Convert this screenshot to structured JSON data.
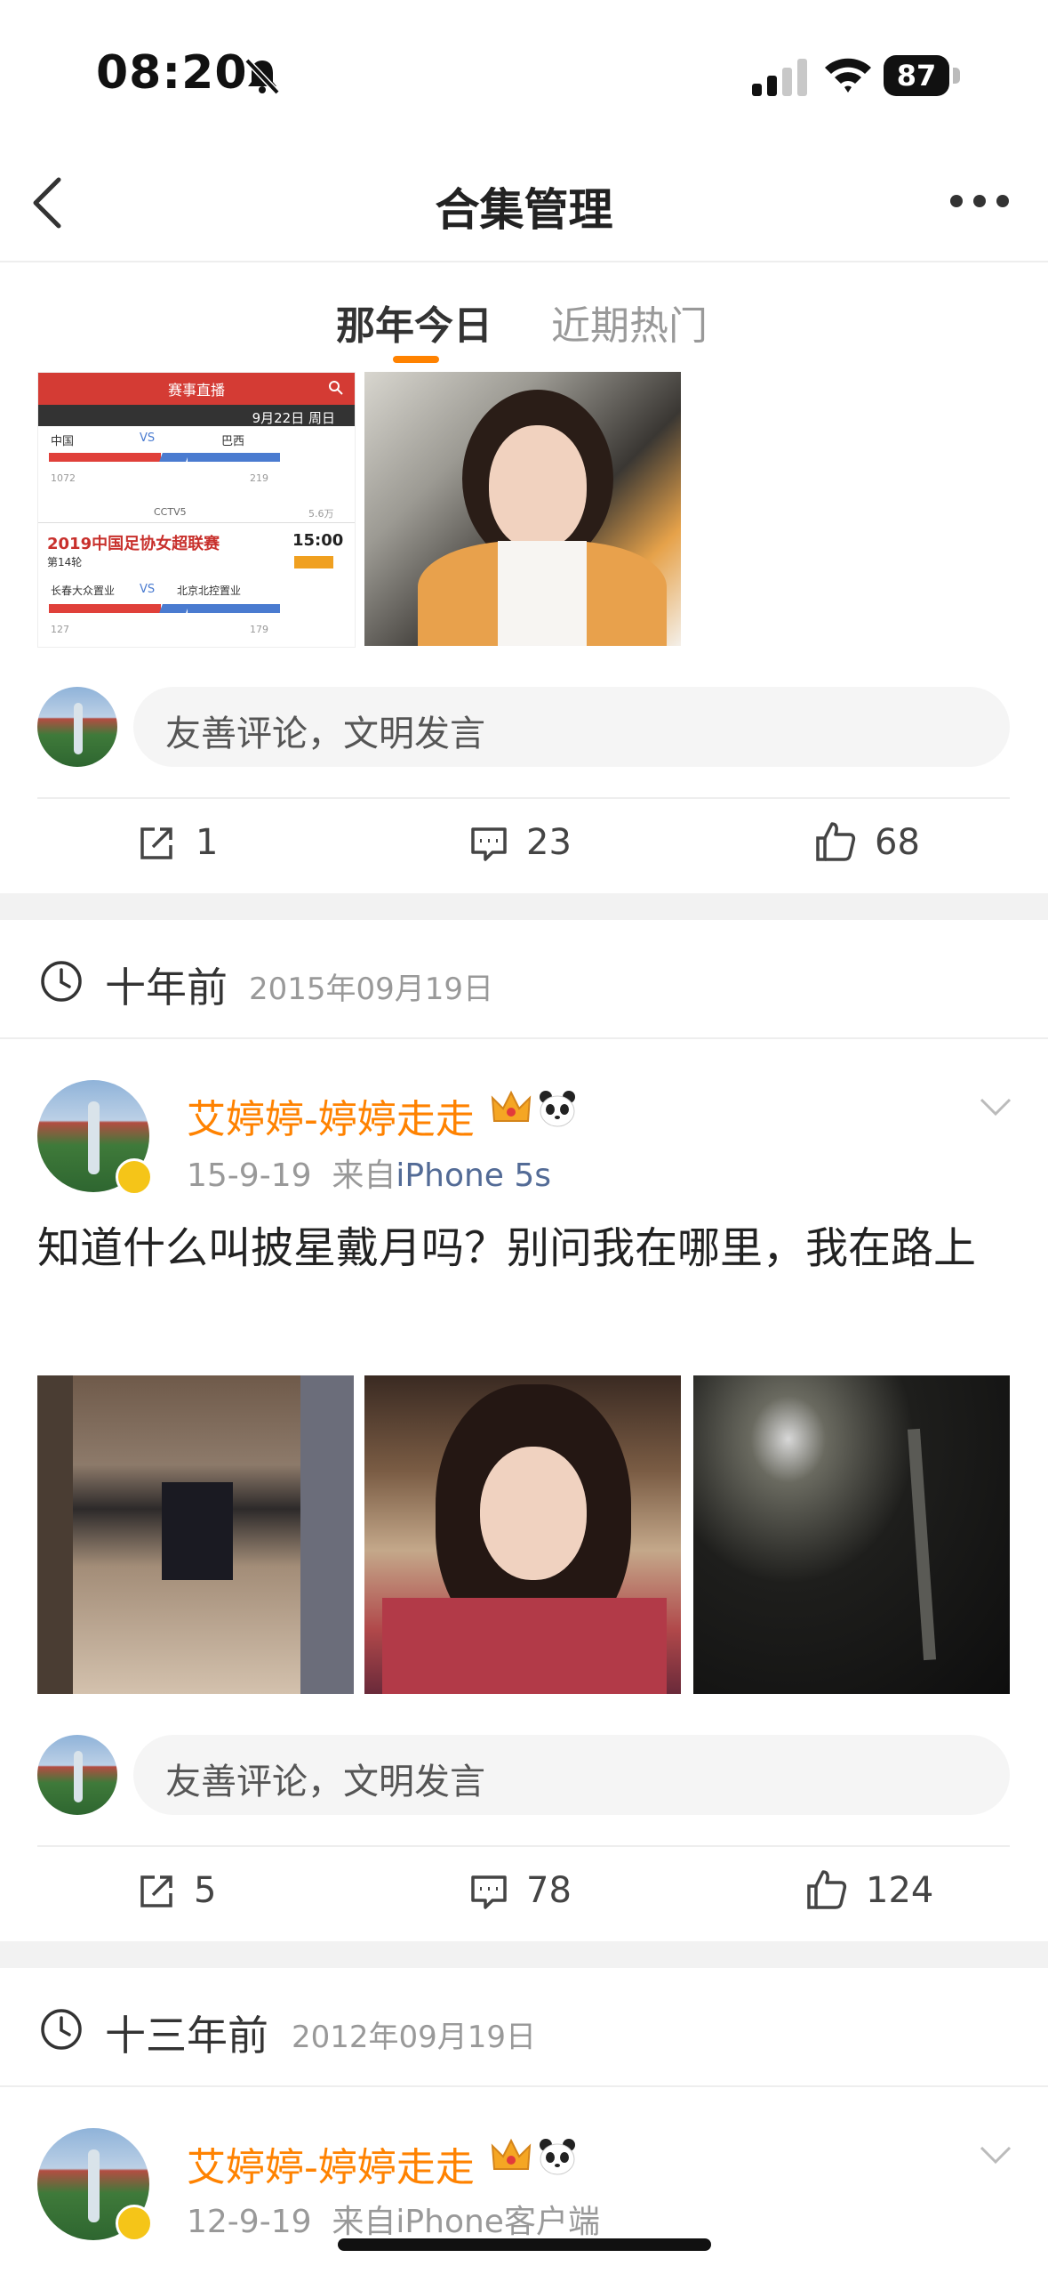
{
  "status_bar": {
    "time": "08:20",
    "battery": "87"
  },
  "nav": {
    "title": "合集管理"
  },
  "tabs": [
    {
      "label": "那年今日",
      "active": true
    },
    {
      "label": "近期热门",
      "active": false
    }
  ],
  "colors": {
    "accent": "#ff8200",
    "source_link": "#536b96"
  },
  "thumb_sports": {
    "header": "赛事直播",
    "date": "9月22日 周日",
    "team_a": "中国",
    "vs": "VS",
    "team_b": "巴西",
    "count_a": "1072",
    "count_b": "219",
    "channel": "CCTV5",
    "views": "5.6万",
    "league": "2019中国足协女超联赛",
    "round": "第14轮",
    "kickoff": "15:00",
    "team_c": "长春大众置业",
    "team_d": "北京北控置业",
    "count_c": "127",
    "count_d": "179"
  },
  "post0": {
    "comment_placeholder": "友善评论，文明发言",
    "shares": "1",
    "comments": "23",
    "likes": "68"
  },
  "section1": {
    "age": "十年前",
    "date": "2015年09月19日"
  },
  "post1": {
    "username": "艾婷婷-婷婷走走",
    "time": "15-9-19",
    "from": "来自",
    "source": "iPhone 5s",
    "text": "知道什么叫披星戴月吗？别问我在哪里，我在路上",
    "comment_placeholder": "友善评论，文明发言",
    "shares": "5",
    "comments": "78",
    "likes": "124"
  },
  "section2": {
    "age": "十三年前",
    "date": "2012年09月19日"
  },
  "post2": {
    "username": "艾婷婷-婷婷走走",
    "time": "12-9-19",
    "from": "来自",
    "source": "iPhone客户端"
  }
}
